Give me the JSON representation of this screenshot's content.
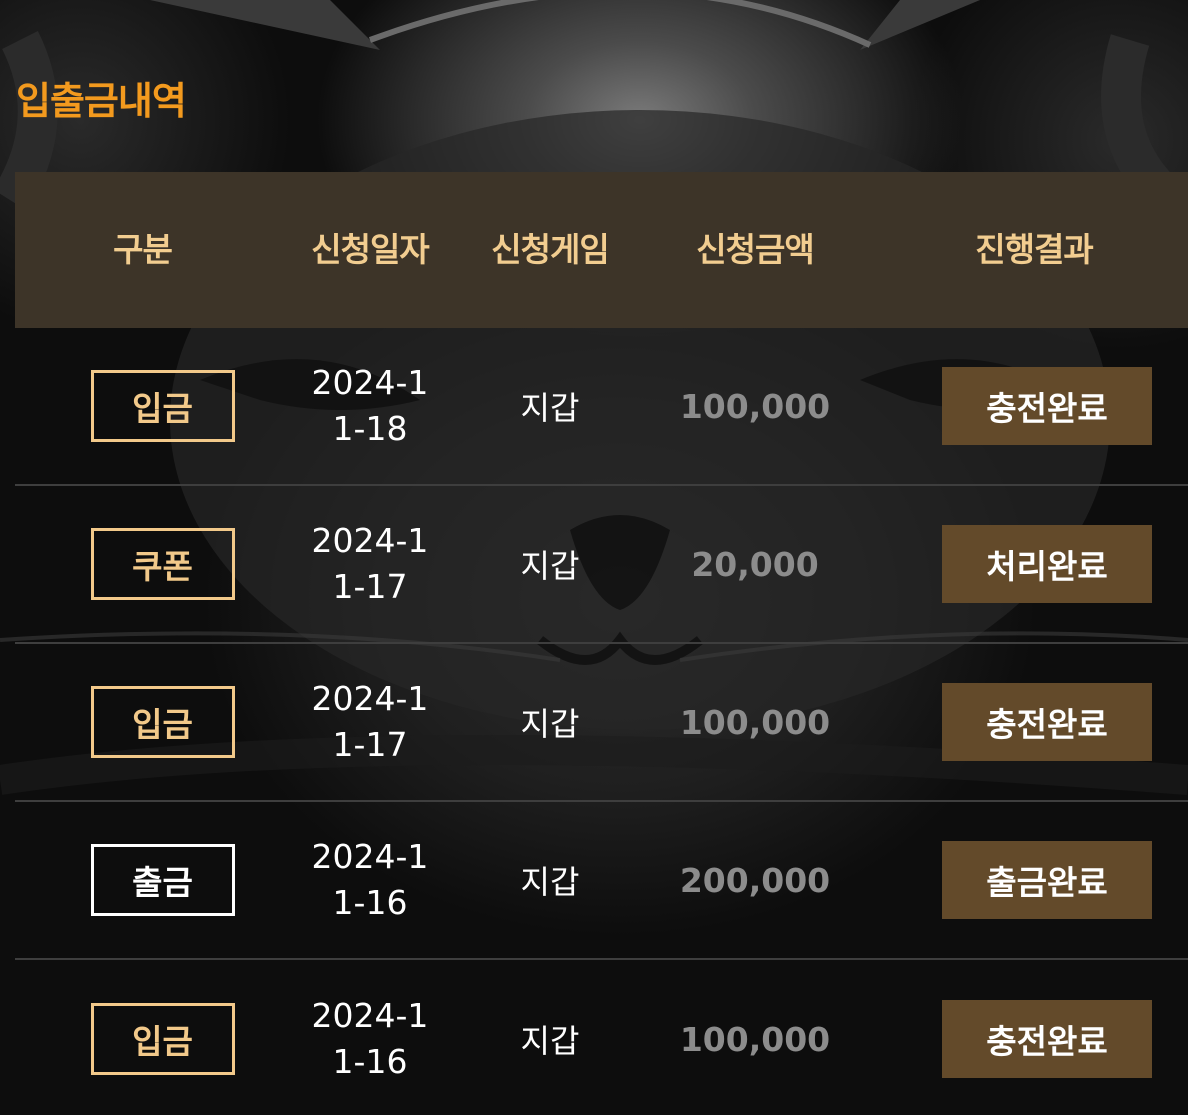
{
  "page": {
    "title": "입출금내역"
  },
  "table": {
    "headers": {
      "type": "구분",
      "date": "신청일자",
      "game": "신청게임",
      "amount": "신청금액",
      "result": "진행결과"
    },
    "rows": [
      {
        "type": "입금",
        "kind": "deposit",
        "date": "2024-11-18",
        "game": "지갑",
        "amount": "100,000",
        "result": "충전완료"
      },
      {
        "type": "쿠폰",
        "kind": "coupon",
        "date": "2024-11-17",
        "game": "지갑",
        "amount": "20,000",
        "result": "처리완료"
      },
      {
        "type": "입금",
        "kind": "deposit",
        "date": "2024-11-17",
        "game": "지갑",
        "amount": "100,000",
        "result": "충전완료"
      },
      {
        "type": "출금",
        "kind": "withdraw",
        "date": "2024-11-16",
        "game": "지갑",
        "amount": "200,000",
        "result": "출금완료"
      },
      {
        "type": "입금",
        "kind": "deposit",
        "date": "2024-11-16",
        "game": "지갑",
        "amount": "100,000",
        "result": "충전완료"
      }
    ]
  },
  "colors": {
    "title": "#f39a1e",
    "header_bg": "#3d3428",
    "header_text": "#f2cd90",
    "badge_border": "#f2c98a",
    "result_bg": "#634a2a",
    "amount_text": "#8c8c8c"
  }
}
